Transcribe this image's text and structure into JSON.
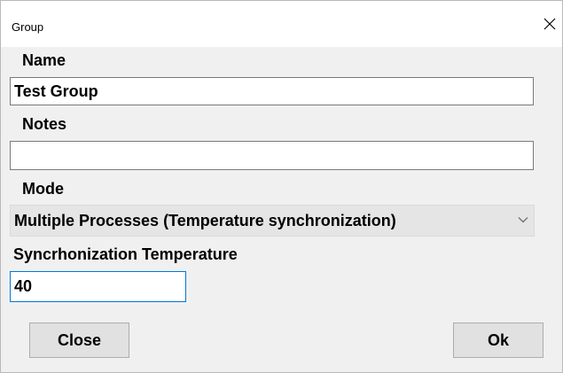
{
  "window": {
    "title": "Group"
  },
  "form": {
    "name_label": "Name",
    "name_value": "Test Group",
    "notes_label": "Notes",
    "notes_value": "",
    "mode_label": "Mode",
    "mode_value": "Multiple Processes (Temperature synchronization)",
    "sync_temp_label": "Syncrhonization Temperature",
    "sync_temp_value": "40"
  },
  "buttons": {
    "close_label": "Close",
    "ok_label": "Ok"
  },
  "icons": {
    "close": "close-icon",
    "dropdown": "chevron-down-icon"
  },
  "colors": {
    "focus_border": "#0078d7",
    "dialog_background": "#f0f0f0"
  }
}
